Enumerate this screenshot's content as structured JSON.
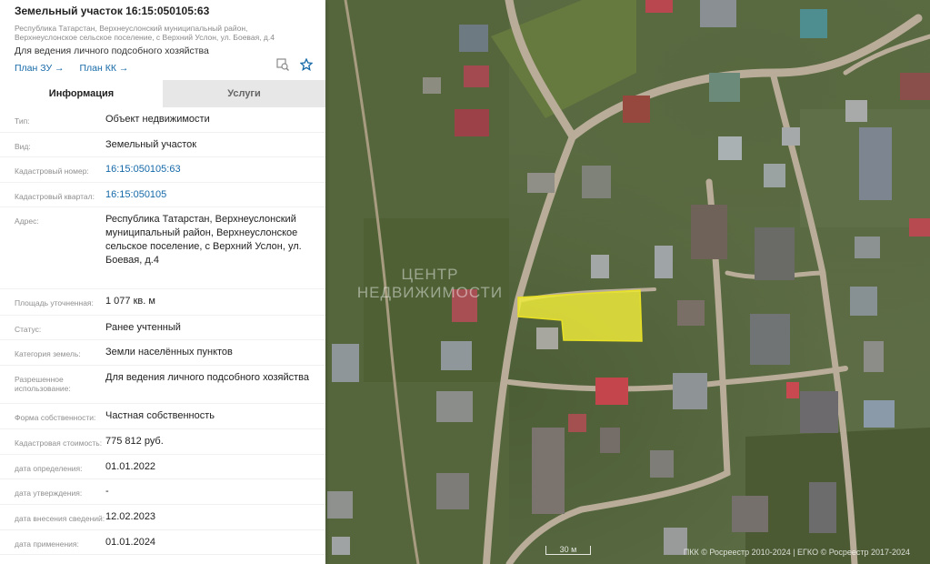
{
  "parcel": {
    "title": "Земельный участок 16:15:050105:63",
    "address_short": "Республика Татарстан, Верхнеуслонский муниципальный район, Верхнеуслонское сельское поселение, с Верхний Услон, ул. Боевая, д.4",
    "purpose": "Для ведения личного подсобного хозяйства"
  },
  "links": {
    "plan_zu": "План ЗУ →",
    "plan_kk": "План КК →"
  },
  "icons": {
    "measure": "measure-icon",
    "favorite": "star-icon"
  },
  "tabs": {
    "info": "Информация",
    "services": "Услуги"
  },
  "info_rows": [
    {
      "label": "Тип:",
      "value": "Объект недвижимости"
    },
    {
      "label": "Вид:",
      "value": "Земельный участок"
    },
    {
      "label": "Кадастровый номер:",
      "value": "16:15:050105:63",
      "link": true
    },
    {
      "label": "Кадастровый квартал:",
      "value": "16:15:050105",
      "link": true
    },
    {
      "label": "Адрес:",
      "value": "Республика Татарстан, Верхнеуслонский муниципальный район, Верхнеуслонское сельское поселение, с Верхний Услон, ул. Боевая, д.4"
    },
    {
      "label": "Площадь уточненная:",
      "value": "1 077 кв. м"
    },
    {
      "label": "Статус:",
      "value": "Ранее учтенный"
    },
    {
      "label": "Категория земель:",
      "value": "Земли населённых пунктов"
    },
    {
      "label": "Разрешенное использование:",
      "value": "Для ведения личного подсобного хозяйства"
    },
    {
      "label": "Форма собственности:",
      "value": "Частная собственность"
    },
    {
      "label": "Кадастровая стоимость:",
      "value": "775 812 руб."
    },
    {
      "label": "дата определения:",
      "value": "01.01.2022"
    },
    {
      "label": "дата утверждения:",
      "value": "-"
    },
    {
      "label": "дата внесения сведений:",
      "value": "12.02.2023"
    },
    {
      "label": "дата применения:",
      "value": "01.01.2024"
    }
  ],
  "map": {
    "watermark": "ЦЕНТР НЕДВИЖИМОСТИ",
    "scale": "30 м",
    "copyright": "ПКК © Росреестр 2010-2024 | ЕГКО © Росреестр 2017-2024",
    "highlight_color": "#f2ee3a"
  }
}
